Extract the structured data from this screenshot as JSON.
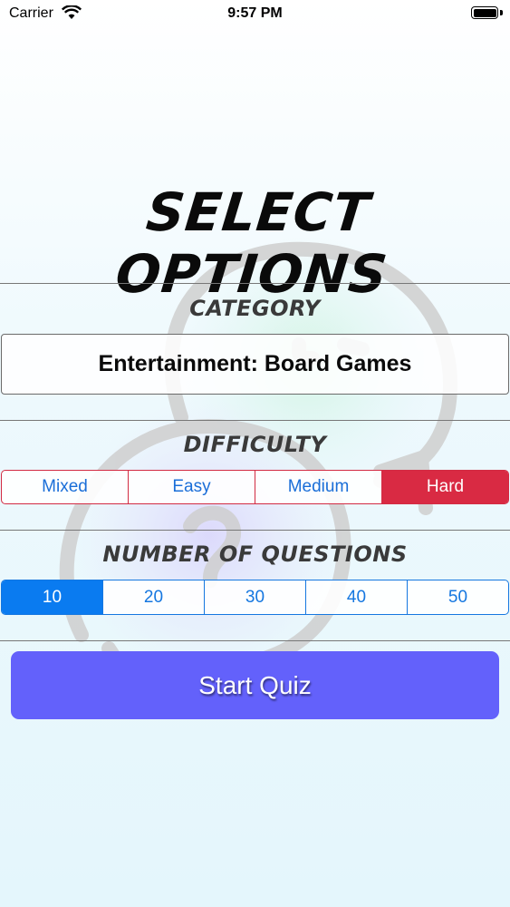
{
  "status_bar": {
    "carrier": "Carrier",
    "time": "9:57 PM",
    "wifi_icon": "wifi-icon",
    "battery_icon": "battery-icon"
  },
  "title": "SELECT OPTIONS",
  "category": {
    "label": "CATEGORY",
    "value": "Entertainment: Board Games"
  },
  "difficulty": {
    "label": "DIFFICULTY",
    "options": [
      "Mixed",
      "Easy",
      "Medium",
      "Hard"
    ],
    "selected": "Hard"
  },
  "questions": {
    "label": "NUMBER OF QUESTIONS",
    "options": [
      "10",
      "20",
      "30",
      "40",
      "50"
    ],
    "selected": "10"
  },
  "start_button": {
    "label": "Start Quiz"
  },
  "colors": {
    "difficulty_accent": "#d92a43",
    "questions_accent": "#0a7bf0",
    "button_bg": "#6361fb"
  }
}
